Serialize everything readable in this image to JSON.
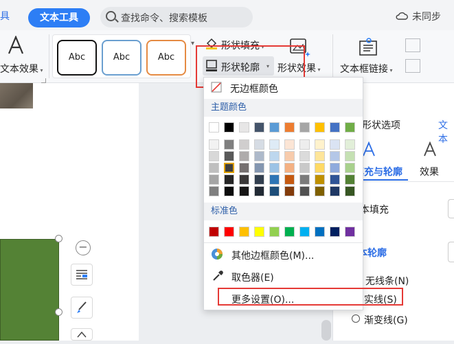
{
  "tabs": {
    "partial_left": "具",
    "text_tools": "文本工具"
  },
  "search": {
    "placeholder": "查找命令、搜索模板"
  },
  "sync": {
    "label": "未同步"
  },
  "ribbon": {
    "text_effect": "文本效果",
    "style_preset": "Abc",
    "shape_fill": "形状填充",
    "shape_outline": "形状轮廓",
    "shape_effect": "形状效果",
    "textbox_link": "文本框链接"
  },
  "outline_menu": {
    "no_border": "无边框颜色",
    "theme_colors": "主题颜色",
    "standard_colors": "标准色",
    "more_border_colors": "其他边框颜色(M)...",
    "eyedropper": "取色器(E)",
    "more_settings": "更多设置(O)...",
    "theme_row": [
      "#ffffff",
      "#000000",
      "#e7e6e6",
      "#44546a",
      "#5b9bd5",
      "#ed7d31",
      "#a5a5a5",
      "#ffc000",
      "#4472c4",
      "#70ad47"
    ],
    "theme_shades": [
      [
        "#f2f2f2",
        "#7f7f7f",
        "#d0cece",
        "#d6dce4",
        "#deebf6",
        "#fbe5d5",
        "#ededed",
        "#fff2cc",
        "#dae3f3",
        "#e2efd9"
      ],
      [
        "#d8d8d8",
        "#595959",
        "#aeabab",
        "#adb9ca",
        "#bdd7ee",
        "#f7cbac",
        "#dbdbdb",
        "#fee599",
        "#b4c7e7",
        "#c5e0b3"
      ],
      [
        "#bfbfbf",
        "#3f3f3f",
        "#757070",
        "#8496b0",
        "#9cc3e5",
        "#f4b183",
        "#c9c9c9",
        "#ffd965",
        "#8faadc",
        "#a8d08d"
      ],
      [
        "#a5a5a5",
        "#262626",
        "#3a3838",
        "#323f4f",
        "#2e75b5",
        "#c55a11",
        "#7b7b7b",
        "#bf9000",
        "#2f5496",
        "#538135"
      ],
      [
        "#7f7f7f",
        "#0c0c0c",
        "#171616",
        "#222a35",
        "#1e4e79",
        "#833c0b",
        "#525252",
        "#7f6000",
        "#1f3864",
        "#375623"
      ]
    ],
    "standard_row": [
      "#c00000",
      "#ff0000",
      "#ffc000",
      "#ffff00",
      "#92d050",
      "#00b050",
      "#00b0f0",
      "#0070c0",
      "#002060",
      "#7030a0"
    ]
  },
  "side_pane": {
    "tab_shape_options": "形状选项",
    "tab_text_partial": "文本",
    "fill_and_outline": "填充与轮廓",
    "effects": "效果",
    "text_fill": "文本填充",
    "text_outline": "文本轮廓",
    "no_line": "无线条(N)",
    "solid_line": "实线(S)",
    "gradient_line": "渐变线(G)"
  }
}
